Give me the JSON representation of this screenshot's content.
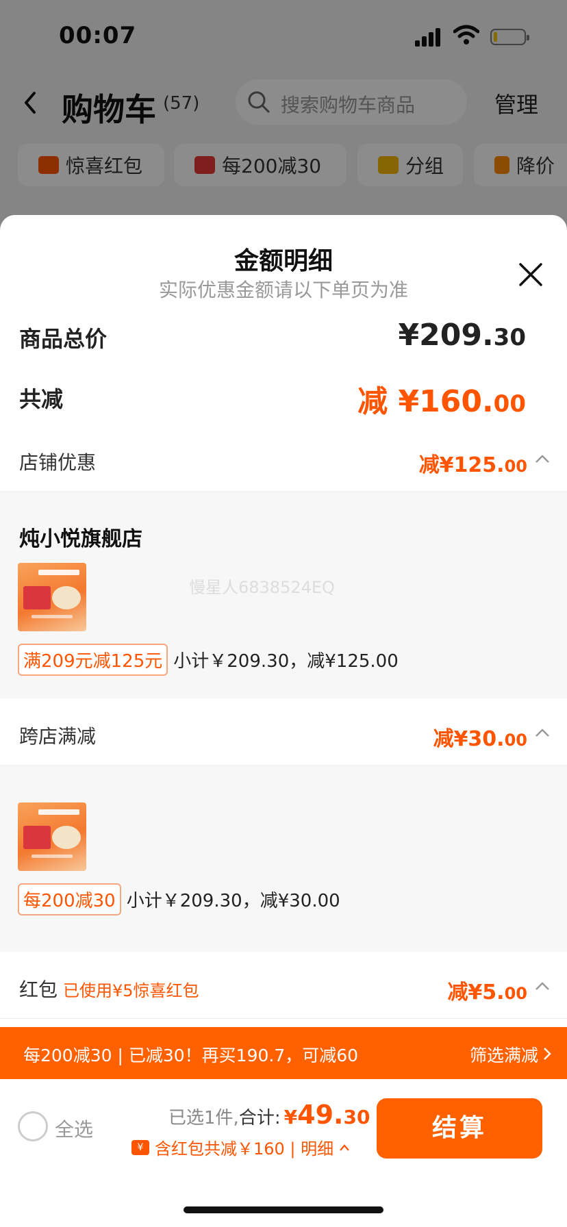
{
  "status_bar": {
    "time": "00:07"
  },
  "nav": {
    "title": "购物车",
    "count": "(57)",
    "search_placeholder": "搜索购物车商品",
    "manage": "管理"
  },
  "chips": [
    {
      "label": "惊喜红包",
      "icon": "red-packet-icon",
      "color": "#ff5500"
    },
    {
      "label": "每200减30",
      "icon": "shop-icon",
      "color": "#e53935"
    },
    {
      "label": "分组",
      "icon": "folder-icon",
      "color": "#f5b800"
    },
    {
      "label": "降价",
      "icon": "down-arrow-icon",
      "color": "#ff8a00"
    }
  ],
  "sheet": {
    "title": "金额明细",
    "subtitle": "实际优惠金额请以下单页为准",
    "total_label": "商品总价",
    "total_value_main": "¥209.",
    "total_value_dec": "30",
    "reduce_label": "共减",
    "reduce_value_main": "减 ¥160.",
    "reduce_value_dec": "00",
    "shop_discount": {
      "label": "店铺优惠",
      "amount_main": "减¥125.",
      "amount_dec": "00",
      "shop_name": "炖小悦旗舰店",
      "tag": "满209元减125元",
      "subtotal": "小计￥209.30，减¥125.00"
    },
    "cross_shop": {
      "label": "跨店满减",
      "amount_main": "减¥30.",
      "amount_dec": "00",
      "tag": "每200减30",
      "subtotal": "小计￥209.30，减¥30.00"
    },
    "red_packet": {
      "label": "红包",
      "note": "已使用¥5惊喜红包",
      "amount_main": "减¥5.",
      "amount_dec": "00"
    },
    "watermark": "慢星人6838524EQ"
  },
  "promo_bar": {
    "text": "每200减30 | 已减30！再买190.7，可减60",
    "action": "筛选满减"
  },
  "checkout": {
    "select_all": "全选",
    "selected": "已选1件,",
    "total_label": "合计:",
    "price_cur": "¥",
    "price_main": "49.",
    "price_dec": "30",
    "discount_text": "含红包共减￥160 | 明细",
    "button": "结算"
  },
  "colors": {
    "accent": "#ff6100",
    "discount_text": "#ff5500"
  }
}
